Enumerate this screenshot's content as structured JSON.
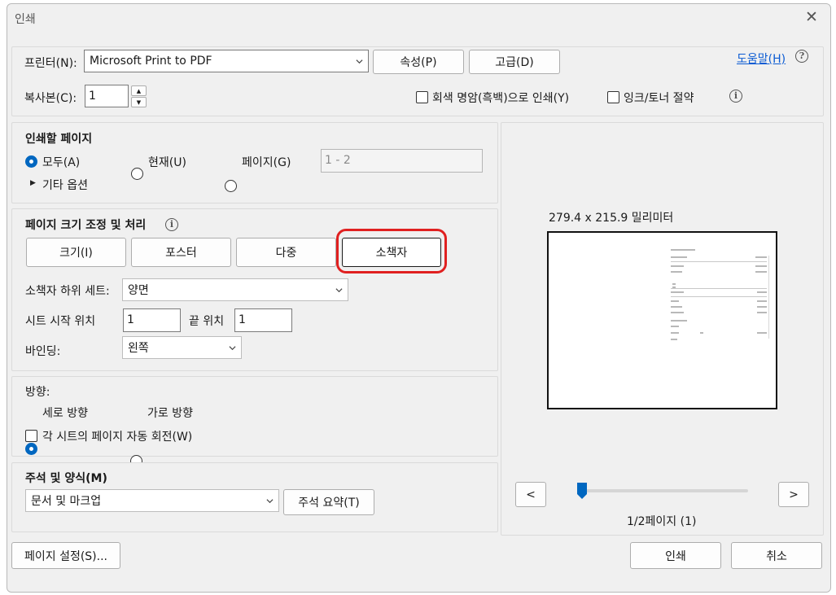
{
  "window": {
    "title": "인쇄",
    "close_glyph": "✕"
  },
  "printer": {
    "label": "프린터(N):",
    "selected": "Microsoft Print to PDF",
    "properties_button": "속성(P)",
    "advanced_button": "고급(D)",
    "help_link": "도움말(H)",
    "help_icon_glyph": "?"
  },
  "copies": {
    "label": "복사본(C):",
    "value": "1",
    "up_glyph": "▲",
    "down_glyph": "▼"
  },
  "options": {
    "grayscale_label": "회색 명암(흑백)으로 인쇄(Y)",
    "grayscale_checked": false,
    "save_ink_label": "잉크/토너 절약",
    "save_ink_checked": false,
    "info_glyph": "i"
  },
  "pages_to_print": {
    "title": "인쇄할 페이지",
    "all_label": "모두(A)",
    "current_label": "현재(U)",
    "pages_label": "페이지(G)",
    "selected": "all",
    "range_value": "1 - 2",
    "more_options": "기타 옵션",
    "more_options_glyph": "▶"
  },
  "page_sizing": {
    "title": "페이지 크기 조정 및 처리",
    "info_glyph": "i",
    "tabs": [
      "크기(I)",
      "포스터",
      "다중",
      "소책자"
    ],
    "active_tab": "소책자",
    "subset_label": "소책자 하위 세트:",
    "subset_value": "양면",
    "sheet_start_label": "시트 시작 위치",
    "sheet_start_value": "1",
    "sheet_end_label": "끝 위치",
    "sheet_end_value": "1",
    "binding_label": "바인딩:",
    "binding_value": "왼쪽"
  },
  "orientation": {
    "title": "방향:",
    "portrait_label": "세로 방향",
    "landscape_label": "가로 방향",
    "selected": "portrait",
    "auto_rotate_label": "각 시트의 페이지 자동 회전(W)",
    "auto_rotate_checked": false
  },
  "comments": {
    "title": "주석 및 양식(M)",
    "selected": "문서 및 마크업",
    "summarize_button": "주석 요약(T)"
  },
  "preview": {
    "paper_size": "279.4 x 215.9 밀리미터",
    "prev_glyph": "<",
    "next_glyph": ">",
    "page_indicator": "1/2페이지 (1)",
    "slider_position": 0
  },
  "footer": {
    "page_setup_button": "페이지 설정(S)...",
    "print_button": "인쇄",
    "cancel_button": "취소"
  },
  "colors": {
    "accent": "#0067c0",
    "highlight": "#e02020",
    "link": "#0b5bd3"
  }
}
